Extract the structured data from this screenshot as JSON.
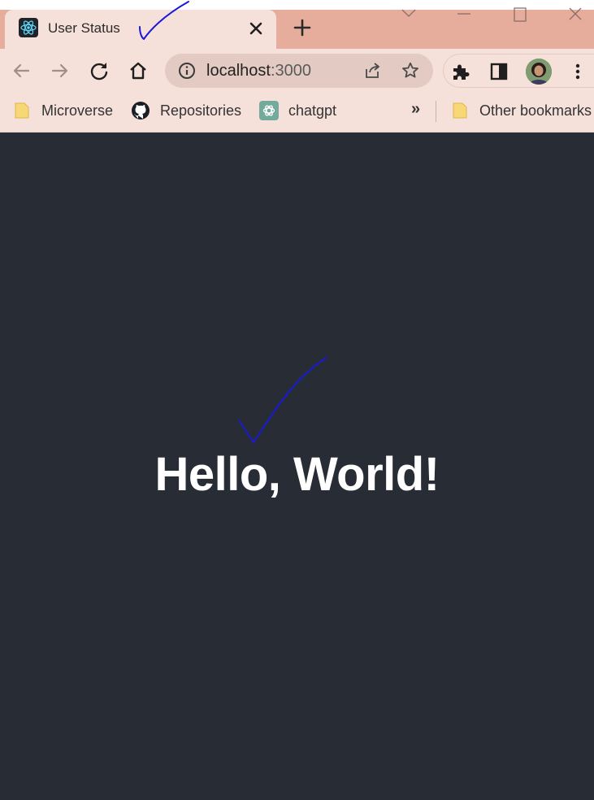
{
  "tab": {
    "title": "User Status",
    "favicon": "react-logo-icon"
  },
  "toolbar": {
    "url_host": "localhost",
    "url_port": ":3000",
    "icons": [
      "back-arrow-icon",
      "forward-arrow-icon",
      "reload-icon",
      "home-icon",
      "info-icon",
      "share-icon",
      "star-icon",
      "puzzle-icon",
      "side-panel-icon",
      "profile-avatar",
      "kebab-menu-icon"
    ]
  },
  "bookmarks": {
    "items": [
      {
        "label": "Microverse",
        "icon": "folder-icon"
      },
      {
        "label": "Repositories",
        "icon": "github-icon"
      },
      {
        "label": "chatgpt",
        "icon": "chatgpt-icon"
      }
    ],
    "overflow": "»",
    "other": "Other bookmarks"
  },
  "page": {
    "heading": "Hello, World!",
    "background": "#282c34",
    "text_color": "#ffffff"
  },
  "colors": {
    "tab_strip": "#e6ac9c",
    "toolbar": "#f6e0da",
    "annotation": "#1a1ad6"
  }
}
